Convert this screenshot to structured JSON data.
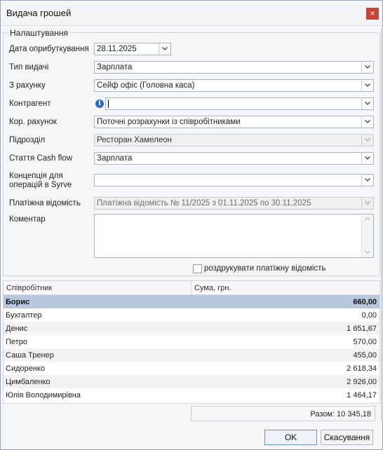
{
  "window": {
    "title": "Видача грошей",
    "close_label": "×"
  },
  "settings": {
    "legend": "Налаштування",
    "fields": {
      "posting_date": {
        "label": "Дата оприбуткування",
        "value": "28.11.2025"
      },
      "payout_type": {
        "label": "Тип видачі",
        "value": "Зарплата"
      },
      "from_account": {
        "label": "З рахунку",
        "value": "Сейф офіс (Головна каса)"
      },
      "counterparty": {
        "label": "Контрагент",
        "value": ""
      },
      "corr_account": {
        "label": "Кор. рахунок",
        "value": "Поточні розрахунки із співробітниками"
      },
      "department": {
        "label": "Підрозділ",
        "value": "Ресторан Хамелеон"
      },
      "cashflow_item": {
        "label": "Стаття Cash flow",
        "value": "Зарплата"
      },
      "syrve_concept": {
        "label": "Концепція для операцій в Syrve",
        "value": ""
      },
      "payroll": {
        "label": "Платіжна відомість",
        "value": "Платіжна відомість № 11/2025 з 01.11.2025 по 30.11.2025"
      },
      "comment": {
        "label": "Коментар",
        "value": ""
      }
    },
    "print_payroll_label": "роздрукувати платіжну відомість"
  },
  "table": {
    "columns": [
      "Співробітник",
      "Сума, грн."
    ],
    "rows": [
      {
        "name": "Борис",
        "amount": "660,00"
      },
      {
        "name": "Бухгалтер",
        "amount": "0,00"
      },
      {
        "name": "Денис",
        "amount": "1 651,67"
      },
      {
        "name": "Петро",
        "amount": "570,00"
      },
      {
        "name": "Саша Тренер",
        "amount": "455,00"
      },
      {
        "name": "Сидоренко",
        "amount": "2 618,34"
      },
      {
        "name": "Цимбаленко",
        "amount": "2 926,00"
      },
      {
        "name": "Юлія Володимирівна",
        "amount": "1 464,17"
      }
    ],
    "total": "Разом: 10 345,18"
  },
  "buttons": {
    "ok": "OK",
    "cancel": "Скасування"
  },
  "colors": {
    "selected_row": "#b8c8dc",
    "close_button": "#c8453b",
    "info_icon": "#2d6bc0"
  }
}
